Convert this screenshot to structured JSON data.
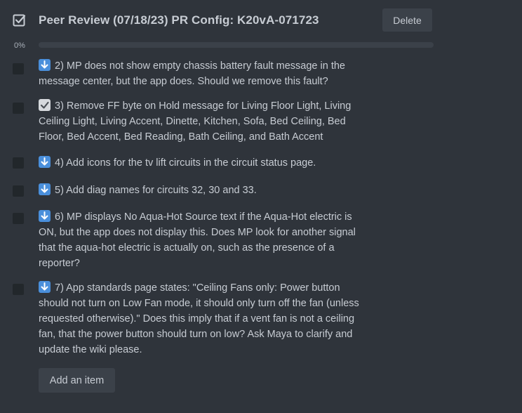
{
  "checklist": {
    "title": "Peer Review (07/18/23) PR Config: K20vA-071723",
    "delete_label": "Delete",
    "progress": {
      "percent_label": "0%",
      "fraction": 0
    },
    "add_item_label": "Add an item",
    "icon": "checklist-icon",
    "items": [
      {
        "emoji": "arrow-down-emoji",
        "text": "2) MP does not show empty chassis battery fault message in the message center, but the app does. Should we remove this fault?",
        "checked": false
      },
      {
        "emoji": "check-mark-emoji",
        "text": "3) Remove FF byte on Hold message for Living Floor Light, Living Ceiling Light, Living Accent, Dinette, Kitchen, Sofa, Bed Ceiling, Bed Floor, Bed Accent, Bed Reading, Bath Ceiling, and Bath Accent",
        "checked": false
      },
      {
        "emoji": "arrow-down-emoji",
        "text": "4) Add icons for the tv lift circuits in the circuit status page.",
        "checked": false
      },
      {
        "emoji": "arrow-down-emoji",
        "text": "5) Add diag names for circuits 32, 30 and 33.",
        "checked": false
      },
      {
        "emoji": "arrow-down-emoji",
        "text": "6) MP displays No Aqua-Hot Source text if the Aqua-Hot electric is ON, but the app does not display this. Does MP look for another signal that the aqua-hot electric is actually on, such as the presence of a reporter?",
        "checked": false
      },
      {
        "emoji": "arrow-down-emoji",
        "text": "7) App standards page states: \"Ceiling Fans only: Power button should not turn on Low Fan mode, it should only turn off the fan (unless requested otherwise).\" Does this imply that if a vent fan is not a ceiling fan, that the power button should turn on low? Ask Maya to clarify and update the wiki please.",
        "checked": false
      }
    ]
  },
  "colors": {
    "background": "#2f343b",
    "text": "#c7ccd3",
    "button_bg": "#3b4149",
    "checkbox_bg": "#22272b",
    "emoji_blue": "#4a8fdb"
  }
}
